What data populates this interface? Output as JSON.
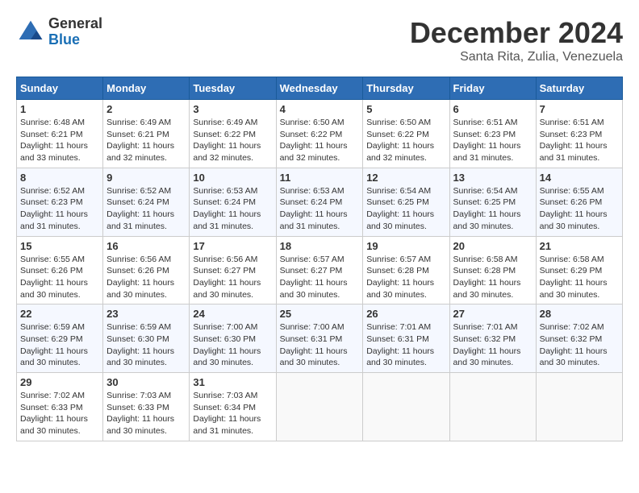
{
  "header": {
    "logo": {
      "line1": "General",
      "line2": "Blue"
    },
    "title": "December 2024",
    "location": "Santa Rita, Zulia, Venezuela"
  },
  "weekdays": [
    "Sunday",
    "Monday",
    "Tuesday",
    "Wednesday",
    "Thursday",
    "Friday",
    "Saturday"
  ],
  "weeks": [
    [
      {
        "day": "1",
        "sunrise": "6:48 AM",
        "sunset": "6:21 PM",
        "daylight": "11 hours and 33 minutes."
      },
      {
        "day": "2",
        "sunrise": "6:49 AM",
        "sunset": "6:21 PM",
        "daylight": "11 hours and 32 minutes."
      },
      {
        "day": "3",
        "sunrise": "6:49 AM",
        "sunset": "6:22 PM",
        "daylight": "11 hours and 32 minutes."
      },
      {
        "day": "4",
        "sunrise": "6:50 AM",
        "sunset": "6:22 PM",
        "daylight": "11 hours and 32 minutes."
      },
      {
        "day": "5",
        "sunrise": "6:50 AM",
        "sunset": "6:22 PM",
        "daylight": "11 hours and 32 minutes."
      },
      {
        "day": "6",
        "sunrise": "6:51 AM",
        "sunset": "6:23 PM",
        "daylight": "11 hours and 31 minutes."
      },
      {
        "day": "7",
        "sunrise": "6:51 AM",
        "sunset": "6:23 PM",
        "daylight": "11 hours and 31 minutes."
      }
    ],
    [
      {
        "day": "8",
        "sunrise": "6:52 AM",
        "sunset": "6:23 PM",
        "daylight": "11 hours and 31 minutes."
      },
      {
        "day": "9",
        "sunrise": "6:52 AM",
        "sunset": "6:24 PM",
        "daylight": "11 hours and 31 minutes."
      },
      {
        "day": "10",
        "sunrise": "6:53 AM",
        "sunset": "6:24 PM",
        "daylight": "11 hours and 31 minutes."
      },
      {
        "day": "11",
        "sunrise": "6:53 AM",
        "sunset": "6:24 PM",
        "daylight": "11 hours and 31 minutes."
      },
      {
        "day": "12",
        "sunrise": "6:54 AM",
        "sunset": "6:25 PM",
        "daylight": "11 hours and 30 minutes."
      },
      {
        "day": "13",
        "sunrise": "6:54 AM",
        "sunset": "6:25 PM",
        "daylight": "11 hours and 30 minutes."
      },
      {
        "day": "14",
        "sunrise": "6:55 AM",
        "sunset": "6:26 PM",
        "daylight": "11 hours and 30 minutes."
      }
    ],
    [
      {
        "day": "15",
        "sunrise": "6:55 AM",
        "sunset": "6:26 PM",
        "daylight": "11 hours and 30 minutes."
      },
      {
        "day": "16",
        "sunrise": "6:56 AM",
        "sunset": "6:26 PM",
        "daylight": "11 hours and 30 minutes."
      },
      {
        "day": "17",
        "sunrise": "6:56 AM",
        "sunset": "6:27 PM",
        "daylight": "11 hours and 30 minutes."
      },
      {
        "day": "18",
        "sunrise": "6:57 AM",
        "sunset": "6:27 PM",
        "daylight": "11 hours and 30 minutes."
      },
      {
        "day": "19",
        "sunrise": "6:57 AM",
        "sunset": "6:28 PM",
        "daylight": "11 hours and 30 minutes."
      },
      {
        "day": "20",
        "sunrise": "6:58 AM",
        "sunset": "6:28 PM",
        "daylight": "11 hours and 30 minutes."
      },
      {
        "day": "21",
        "sunrise": "6:58 AM",
        "sunset": "6:29 PM",
        "daylight": "11 hours and 30 minutes."
      }
    ],
    [
      {
        "day": "22",
        "sunrise": "6:59 AM",
        "sunset": "6:29 PM",
        "daylight": "11 hours and 30 minutes."
      },
      {
        "day": "23",
        "sunrise": "6:59 AM",
        "sunset": "6:30 PM",
        "daylight": "11 hours and 30 minutes."
      },
      {
        "day": "24",
        "sunrise": "7:00 AM",
        "sunset": "6:30 PM",
        "daylight": "11 hours and 30 minutes."
      },
      {
        "day": "25",
        "sunrise": "7:00 AM",
        "sunset": "6:31 PM",
        "daylight": "11 hours and 30 minutes."
      },
      {
        "day": "26",
        "sunrise": "7:01 AM",
        "sunset": "6:31 PM",
        "daylight": "11 hours and 30 minutes."
      },
      {
        "day": "27",
        "sunrise": "7:01 AM",
        "sunset": "6:32 PM",
        "daylight": "11 hours and 30 minutes."
      },
      {
        "day": "28",
        "sunrise": "7:02 AM",
        "sunset": "6:32 PM",
        "daylight": "11 hours and 30 minutes."
      }
    ],
    [
      {
        "day": "29",
        "sunrise": "7:02 AM",
        "sunset": "6:33 PM",
        "daylight": "11 hours and 30 minutes."
      },
      {
        "day": "30",
        "sunrise": "7:03 AM",
        "sunset": "6:33 PM",
        "daylight": "11 hours and 30 minutes."
      },
      {
        "day": "31",
        "sunrise": "7:03 AM",
        "sunset": "6:34 PM",
        "daylight": "11 hours and 31 minutes."
      },
      null,
      null,
      null,
      null
    ]
  ]
}
